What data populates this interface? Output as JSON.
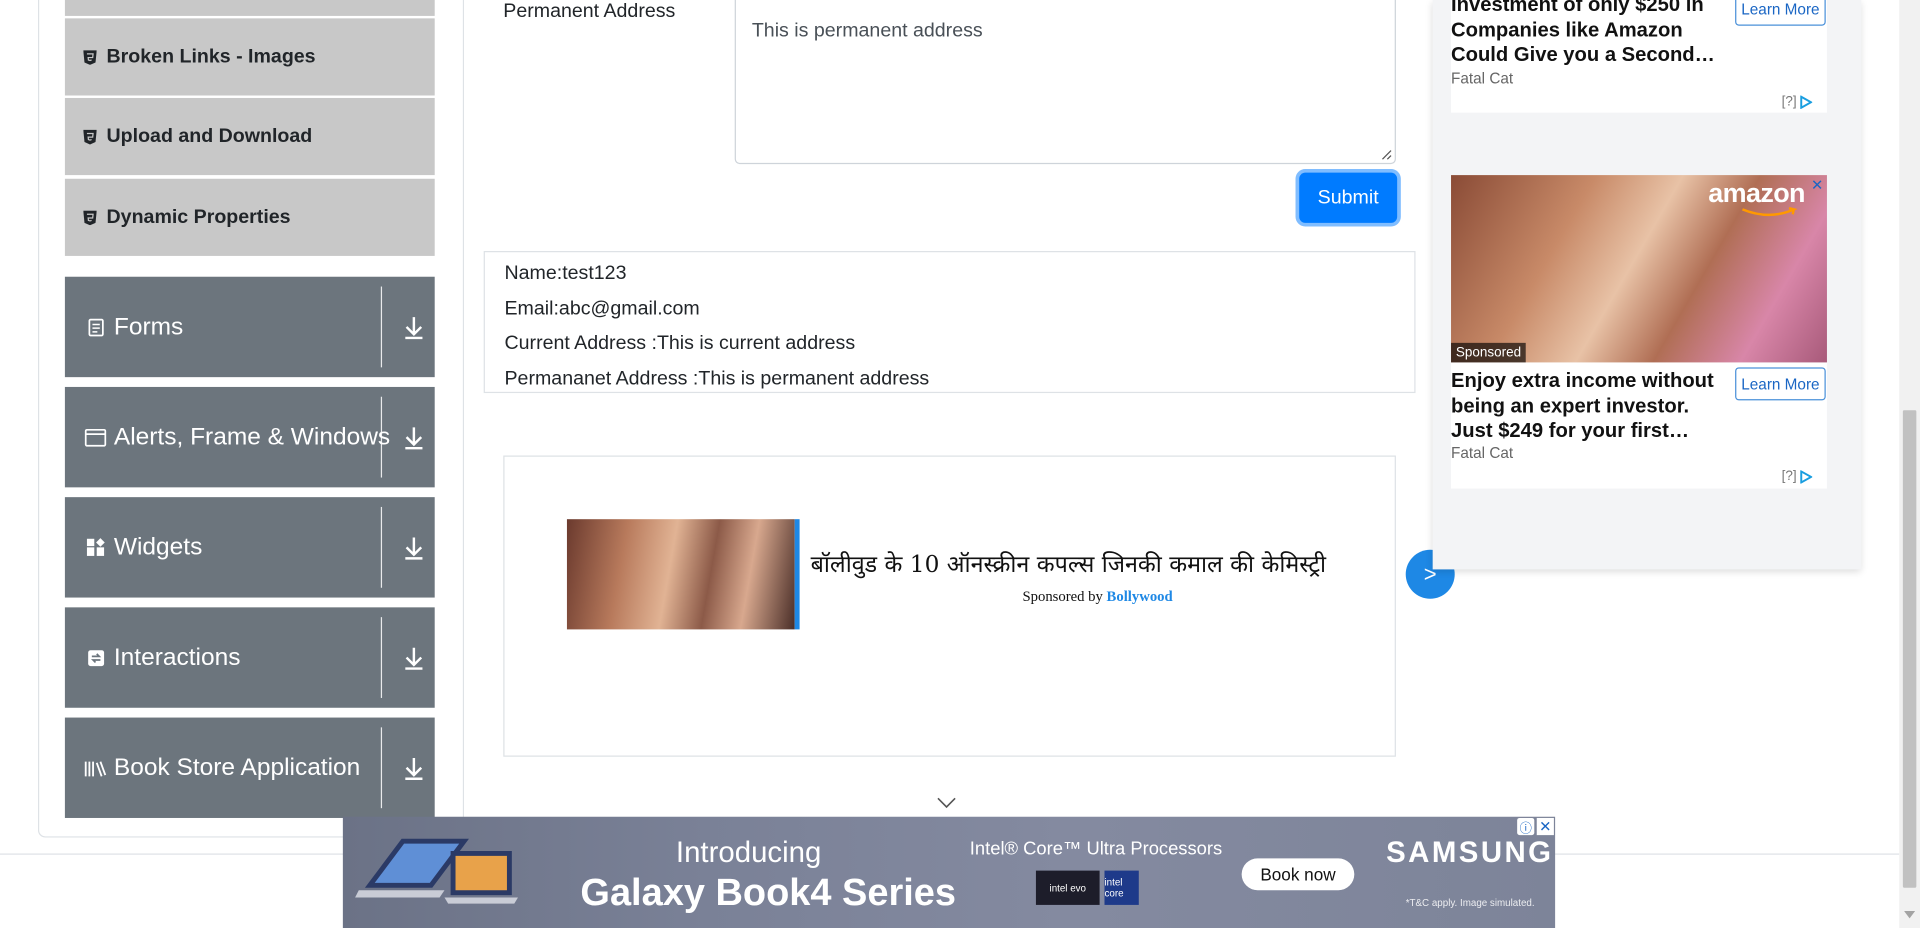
{
  "sidebar": {
    "sub_items": [
      {
        "label": "Broken Links - Images"
      },
      {
        "label": "Upload and Download"
      },
      {
        "label": "Dynamic Properties"
      }
    ],
    "categories": [
      {
        "label": "Forms",
        "icon": "form-icon"
      },
      {
        "label": "Alerts, Frame & Windows",
        "icon": "window-icon"
      },
      {
        "label": "Widgets",
        "icon": "widgets-icon"
      },
      {
        "label": "Interactions",
        "icon": "interactions-icon"
      },
      {
        "label": "Book Store Application",
        "icon": "books-icon"
      }
    ]
  },
  "form": {
    "permanent_label": "Permanent Address",
    "permanent_value": "This is permanent address",
    "submit_label": "Submit"
  },
  "output": {
    "name": "Name:test123",
    "email": "Email:abc@gmail.com",
    "current": "Current Address :This is current address",
    "permanent": "Permananet Address :This is permanent address"
  },
  "native_ad": {
    "title": "बॉलीवुड के 10 ऑनस्क्रीन कपल्स जिनकी कमाल की केमिस्ट्री",
    "sponsored_prefix": "Sponsored by",
    "sponsor": "Bollywood",
    "next": ">"
  },
  "right_ads": {
    "ad1": {
      "text": "Investment of only $250 in Companies like Amazon Could Give you a Second…",
      "source": "Fatal Cat",
      "cta": "Learn More",
      "choice": "[?]"
    },
    "ad2": {
      "brand": "amazon",
      "tag": "Sponsored",
      "text": "Enjoy extra income without being an expert investor. Just $249 for your first…",
      "source": "Fatal Cat",
      "cta": "Learn More",
      "choice": "[?]"
    }
  },
  "banner": {
    "intro": "Introducing",
    "product": "Galaxy Book4 Series",
    "processor": "Intel® Core™ Ultra Processors",
    "logo1": "intel evo",
    "logo2": "intel core",
    "cta": "Book now",
    "brand": "SAMSUNG",
    "disclaimer": "*T&C apply. Image simulated."
  },
  "colors": {
    "category_bg": "#6c757d",
    "sub_item_bg": "#c8c8c8",
    "primary": "#007bff"
  }
}
